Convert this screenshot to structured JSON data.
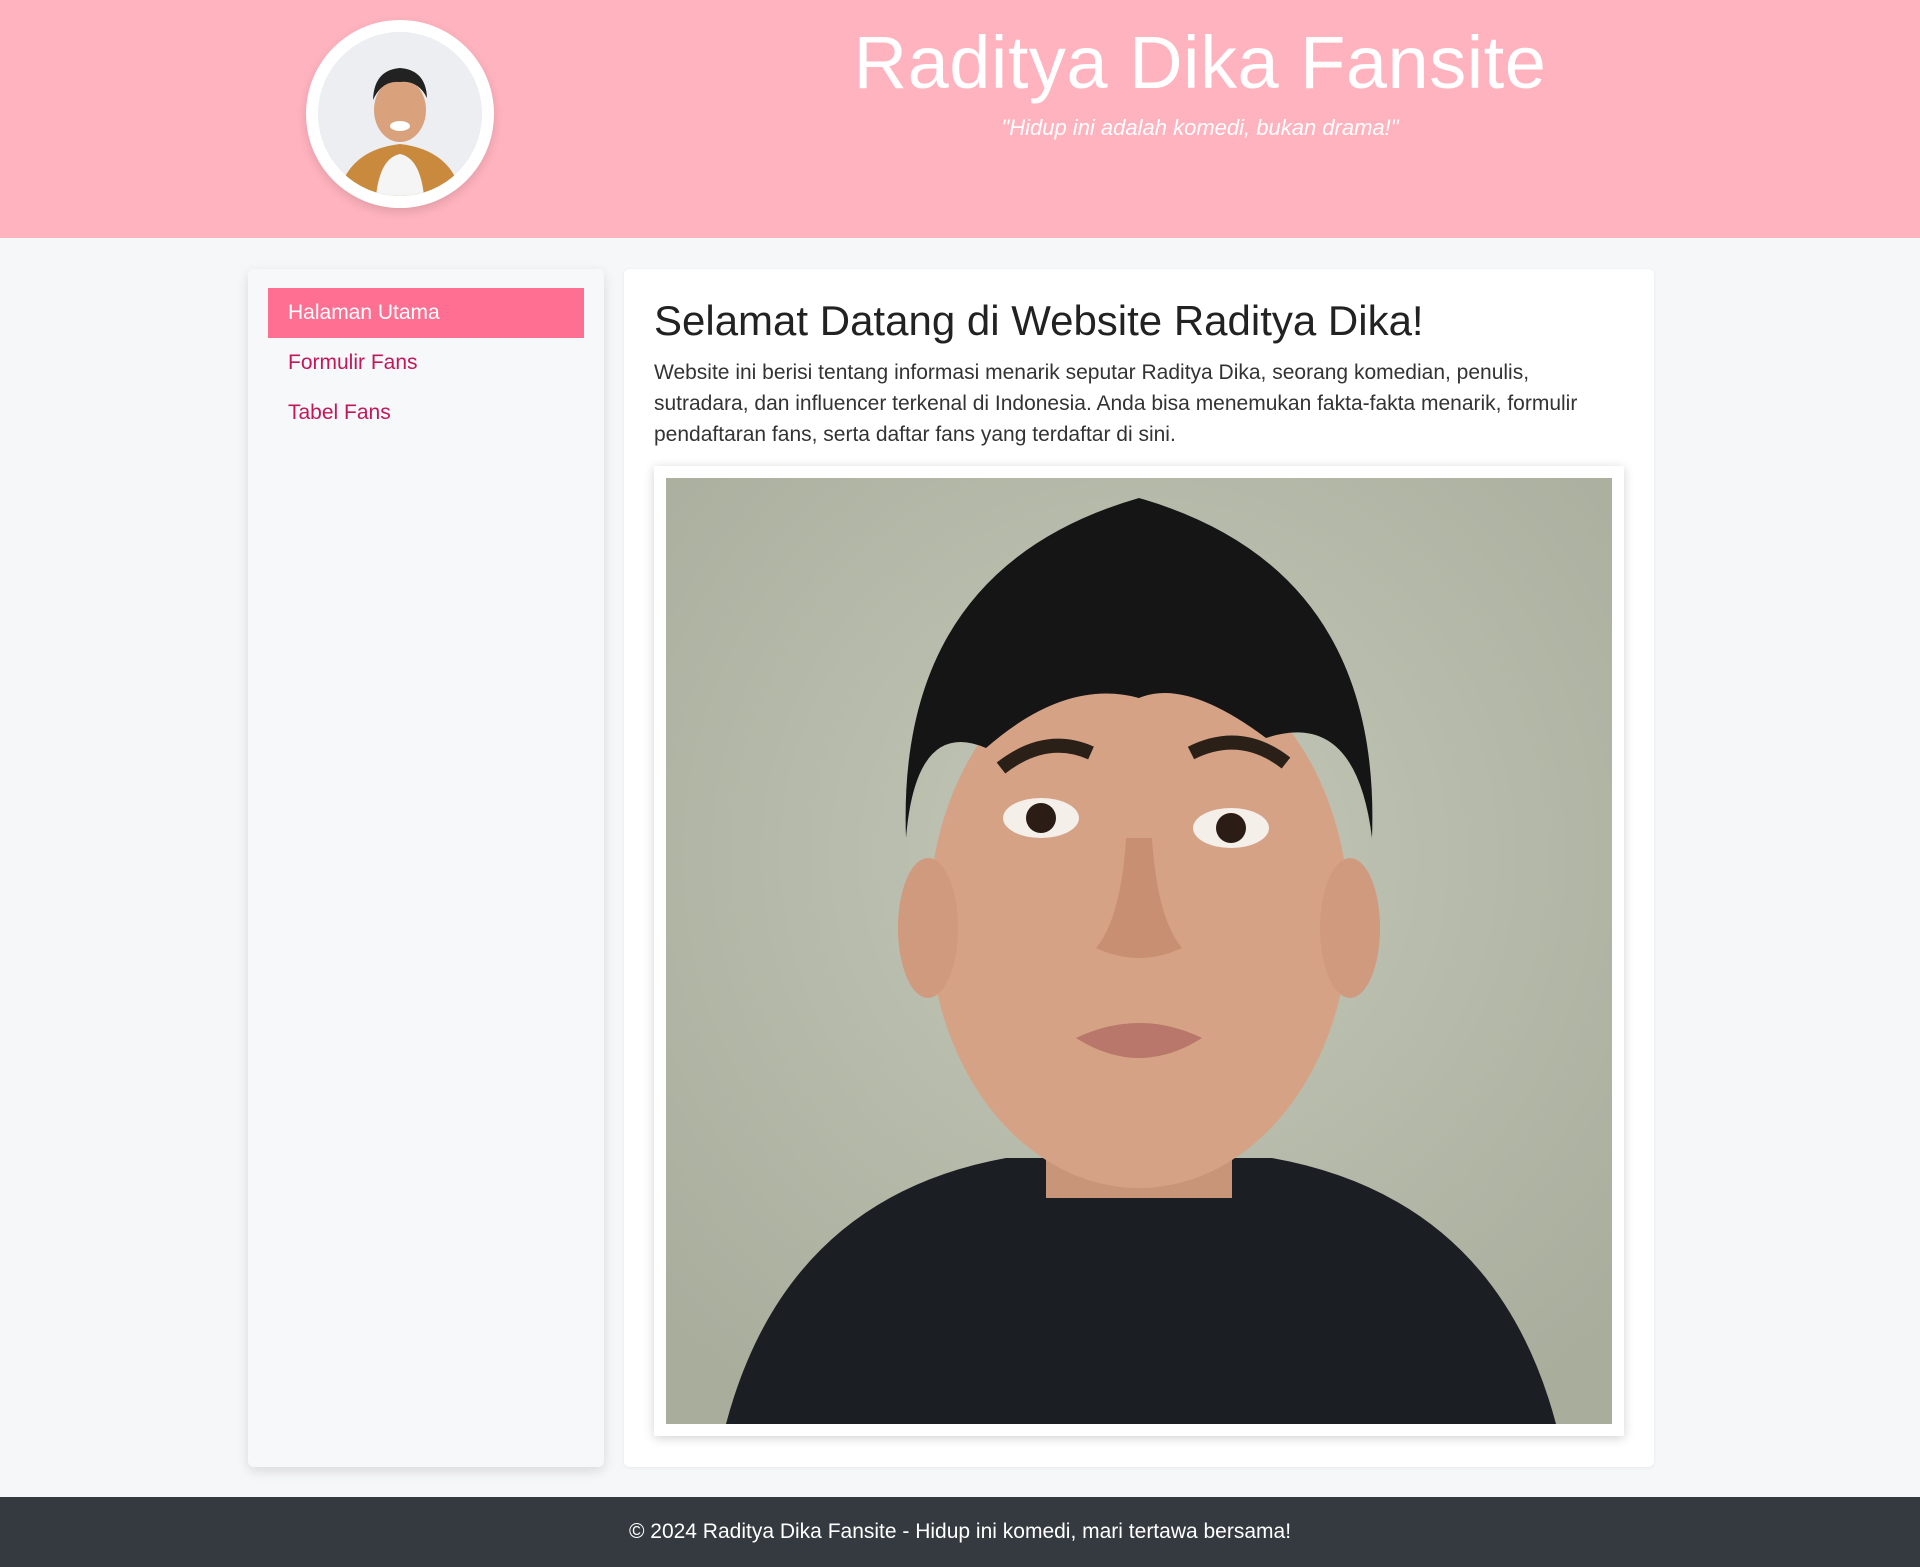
{
  "header": {
    "title": "Raditya Dika Fansite",
    "tagline": "\"Hidup ini adalah komedi, bukan drama!\"",
    "background": "#ffb3be"
  },
  "sidebar": {
    "items": [
      {
        "label": "Halaman Utama",
        "active": true
      },
      {
        "label": "Formulir Fans",
        "active": false
      },
      {
        "label": "Tabel Fans",
        "active": false
      }
    ],
    "active_color": "#ff6f91",
    "link_color": "#c2185b"
  },
  "main": {
    "heading": "Selamat Datang di Website Raditya Dika!",
    "intro": "Website ini berisi tentang informasi menarik seputar Raditya Dika, seorang komedian, penulis, sutradara, dan influencer terkenal di Indonesia. Anda bisa menemukan fakta-fakta menarik, formulir pendaftaran fans, serta daftar fans yang terdaftar di sini."
  },
  "footer": {
    "text": "© 2024 Raditya Dika Fansite - Hidup ini komedi, mari tertawa bersama!",
    "background": "#343a40"
  }
}
